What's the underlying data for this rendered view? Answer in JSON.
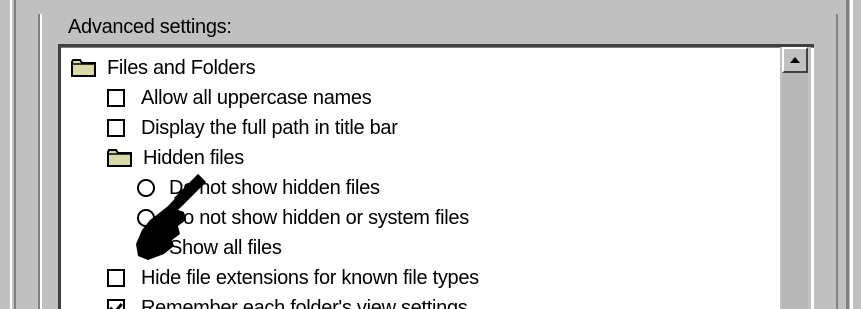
{
  "group": {
    "title": "Advanced settings:"
  },
  "tree": {
    "items": [
      {
        "type": "folder",
        "label": "Files and Folders",
        "icon": "folder-icon"
      },
      {
        "type": "checkbox",
        "label": "Allow all uppercase names",
        "checked": false
      },
      {
        "type": "checkbox",
        "label": "Display the full path in title bar",
        "checked": false
      },
      {
        "type": "folder",
        "label": "Hidden files",
        "icon": "folder-icon"
      },
      {
        "type": "radio",
        "label": "Do not show hidden files",
        "selected": false
      },
      {
        "type": "radio",
        "label": "Do not show hidden or system files",
        "selected": false
      },
      {
        "type": "radio",
        "label": "Show all files",
        "selected": false
      },
      {
        "type": "checkbox",
        "label": "Hide file extensions for known file types",
        "checked": false
      },
      {
        "type": "checkbox",
        "label": "Remember each folder's view settings",
        "checked": true
      }
    ]
  },
  "scrollbar": {
    "up_icon": "scroll-up-arrow-icon"
  },
  "cursor": {
    "icon": "hand-pointer-icon"
  },
  "colors": {
    "face": "#c0c0c0",
    "shadow": "#808080",
    "highlight": "#ffffff",
    "dark": "#404040"
  }
}
